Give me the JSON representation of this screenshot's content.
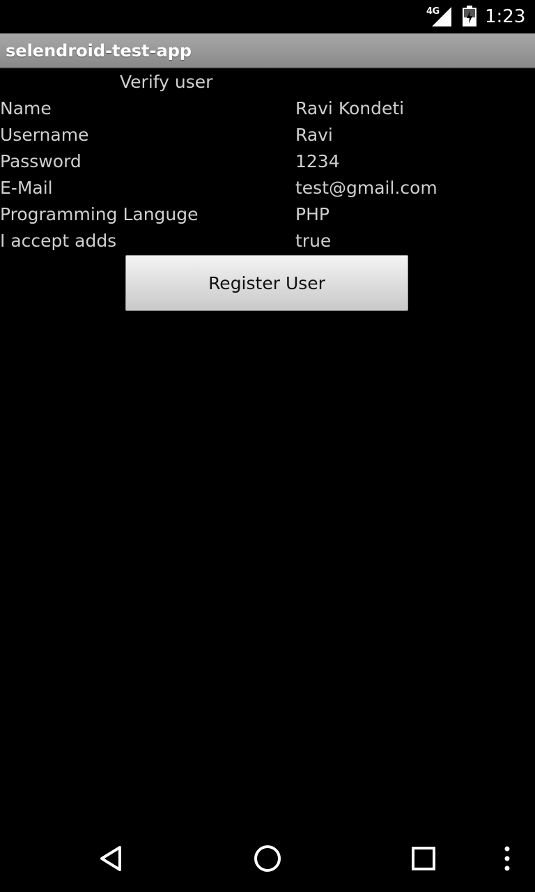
{
  "status_bar": {
    "network": "4G",
    "time": "1:23",
    "icons": [
      "signal-icon",
      "battery-icon"
    ]
  },
  "app": {
    "title": "selendroid-test-app"
  },
  "main": {
    "heading": "Verify user",
    "rows": [
      {
        "label": "Name",
        "value": "Ravi Kondeti"
      },
      {
        "label": "Username",
        "value": "Ravi"
      },
      {
        "label": "Password",
        "value": "1234"
      },
      {
        "label": "E-Mail",
        "value": "test@gmail.com"
      },
      {
        "label": "Programming Languge",
        "value": "PHP"
      },
      {
        "label": "I accept adds",
        "value": "true"
      }
    ],
    "register_button_label": "Register User"
  },
  "nav_bar": {
    "icons": [
      "back-icon",
      "home-icon",
      "recents-icon",
      "overflow-menu-icon"
    ]
  },
  "colors": {
    "background": "#000000",
    "text": "#cfcfcf",
    "title_bar": "#999999",
    "button": "#dcdcdc"
  }
}
